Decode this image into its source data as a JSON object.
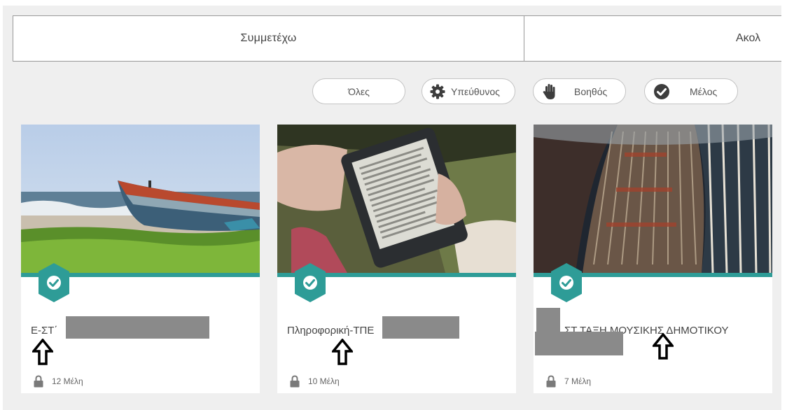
{
  "tabs": [
    {
      "label": "Συμμετέχω"
    },
    {
      "label": "Ακολ"
    }
  ],
  "filters": {
    "all": "Όλες",
    "owner": "Υπεύθυνος",
    "helper": "Βοηθός",
    "member": "Μέλος"
  },
  "cards": [
    {
      "title": "Ε-ΣΤ΄",
      "members": "12 Μέλη"
    },
    {
      "title": "Πληροφορική-ΤΠΕ",
      "members": "10 Μέλη"
    },
    {
      "title": "ΣΤ ΤΑΞΗ ΜΟΥΣΙΚΗΣ ΔΗΜΟΤΙΚΟΥ",
      "members": "7 Μέλη"
    }
  ],
  "colors": {
    "accent": "#2e9c97",
    "redaction": "#8a8a8a",
    "page_bg": "#efefef"
  },
  "icons": {
    "owner": "gear-icon",
    "helper": "hand-icon",
    "member": "check-circle-icon",
    "badge": "check-badge-icon",
    "members": "lock-icon",
    "annotation": "up-arrow-icon"
  }
}
